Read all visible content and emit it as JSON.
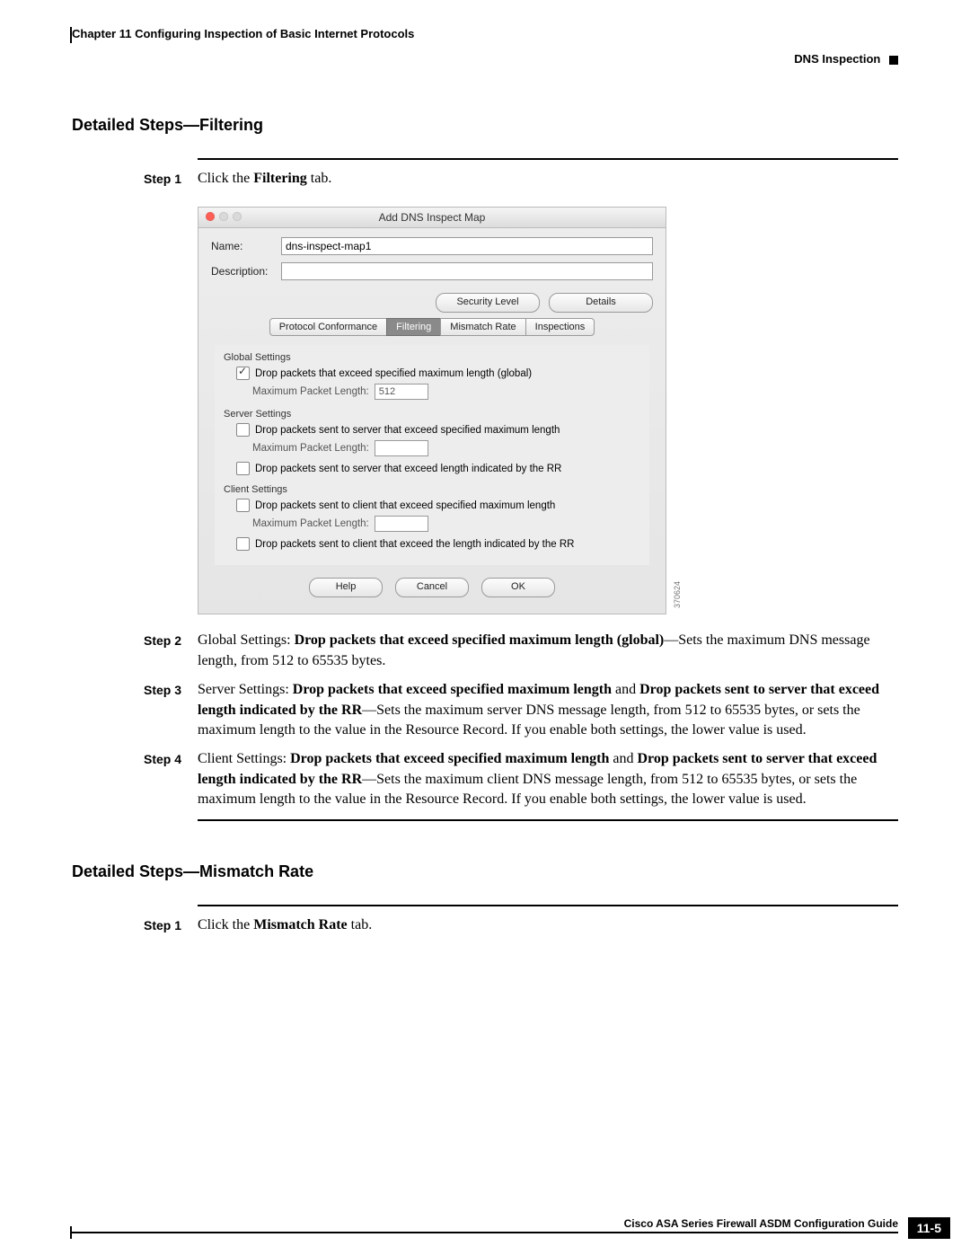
{
  "header": {
    "chapter": "Chapter 11    Configuring Inspection of Basic Internet Protocols",
    "section": "DNS Inspection"
  },
  "sections": {
    "filtering_title": "Detailed Steps—Filtering",
    "mismatch_title": "Detailed Steps—Mismatch Rate"
  },
  "steps_filtering": {
    "s1_label": "Step 1",
    "s1_pre": "Click the ",
    "s1_bold": "Filtering",
    "s1_post": " tab.",
    "s2_label": "Step 2",
    "s2_pre": "Global Settings: ",
    "s2_bold": "Drop packets that exceed specified maximum length (global)",
    "s2_post": "—Sets the maximum DNS message length, from 512 to 65535 bytes.",
    "s3_label": "Step 3",
    "s3_pre": "Server Settings: ",
    "s3_b1": "Drop packets that exceed specified maximum length",
    "s3_mid1": " and ",
    "s3_b2": "Drop packets sent to server that exceed length indicated by the RR",
    "s3_post": "—Sets the maximum server DNS message length, from 512 to 65535 bytes, or sets the maximum length to the value in the Resource Record. If you enable both settings, the lower value is used.",
    "s4_label": "Step 4",
    "s4_pre": "Client Settings: ",
    "s4_b1": "Drop packets that exceed specified maximum length",
    "s4_mid1": " and ",
    "s4_b2": "Drop packets sent to server that exceed length indicated by the RR",
    "s4_post": "—Sets the maximum client DNS message length, from 512 to 65535 bytes, or sets the maximum length to the value in the Resource Record. If you enable both settings, the lower value is used."
  },
  "steps_mismatch": {
    "s1_label": "Step 1",
    "s1_pre": "Click the ",
    "s1_bold": "Mismatch Rate",
    "s1_post": " tab."
  },
  "dialog": {
    "title": "Add DNS Inspect Map",
    "name_label": "Name:",
    "name_value": "dns-inspect-map1",
    "desc_label": "Description:",
    "desc_value": "",
    "btn_security": "Security Level",
    "btn_details": "Details",
    "tabs": {
      "t1": "Protocol Conformance",
      "t2": "Filtering",
      "t3": "Mismatch Rate",
      "t4": "Inspections"
    },
    "grp_global": "Global Settings",
    "ck_global": "Drop packets that exceed specified maximum length (global)",
    "mpl_label": "Maximum Packet Length:",
    "mpl_global_value": "512",
    "grp_server": "Server Settings",
    "ck_server1": "Drop packets sent to server that exceed specified maximum length",
    "mpl_server_value": "",
    "ck_server2": "Drop packets sent to server that exceed length indicated by the RR",
    "grp_client": "Client Settings",
    "ck_client1": "Drop packets sent to client  that exceed specified maximum length",
    "mpl_client_value": "",
    "ck_client2": "Drop packets sent to client that exceed the length indicated by the RR",
    "btn_help": "Help",
    "btn_cancel": "Cancel",
    "btn_ok": "OK",
    "side_id": "370624"
  },
  "footer": {
    "guide": "Cisco ASA Series Firewall ASDM Configuration Guide",
    "page": "11-5"
  }
}
